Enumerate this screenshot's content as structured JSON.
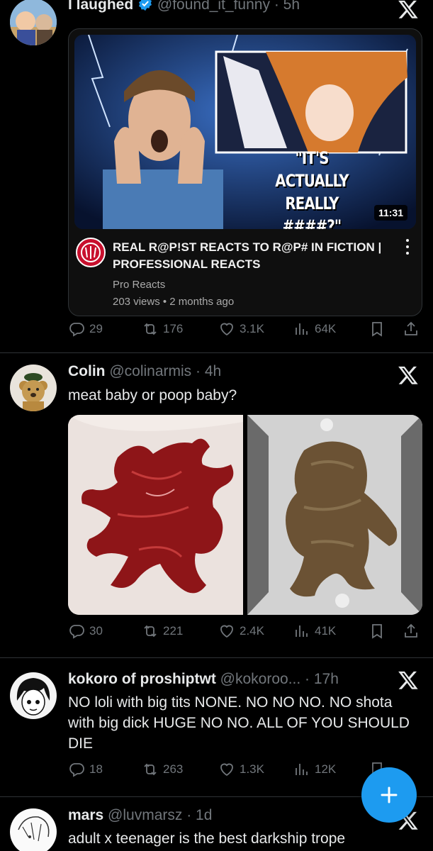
{
  "tweets": [
    {
      "name": "I laughed",
      "handle": "@found_it_funny",
      "time": "· 5h",
      "verified": true,
      "card": {
        "thumb_quote": "\"IT'S ACTUALLY REALLY ####?\"",
        "duration": "11:31",
        "title": "REAL R@P!ST REACTS TO R@P# IN FICTION | PROFESSIONAL REACTS",
        "channel": "Pro Reacts",
        "views": "203 views • 2 months ago"
      },
      "stats": {
        "replies": "29",
        "reposts": "176",
        "likes": "3.1K",
        "views": "64K"
      }
    },
    {
      "name": "Colin",
      "handle": "@colinarmis",
      "time": "· 4h",
      "text": "meat baby or poop baby?",
      "stats": {
        "replies": "30",
        "reposts": "221",
        "likes": "2.4K",
        "views": "41K"
      }
    },
    {
      "name": "kokoro of proshiptwt",
      "handle": "@kokoroo...",
      "time": "· 17h",
      "text": "NO loli with big tits NONE. NO NO NO. NO shota with big dick HUGE NO NO. ALL OF YOU SHOULD DIE",
      "stats": {
        "replies": "18",
        "reposts": "263",
        "likes": "1.3K",
        "views": "12K"
      }
    },
    {
      "name": "mars",
      "handle": "@luvmarsz",
      "time": "· 1d",
      "text": "adult x teenager is the best darkship trope"
    }
  ],
  "colors": {
    "background": "#000000",
    "accent": "#1d9bf0",
    "muted": "#71767b",
    "text": "#e7e9ea"
  },
  "icons": [
    "reply-icon",
    "repost-icon",
    "like-icon",
    "views-icon",
    "bookmark-icon",
    "share-icon",
    "x-logo-icon",
    "compose-plus-icon"
  ]
}
